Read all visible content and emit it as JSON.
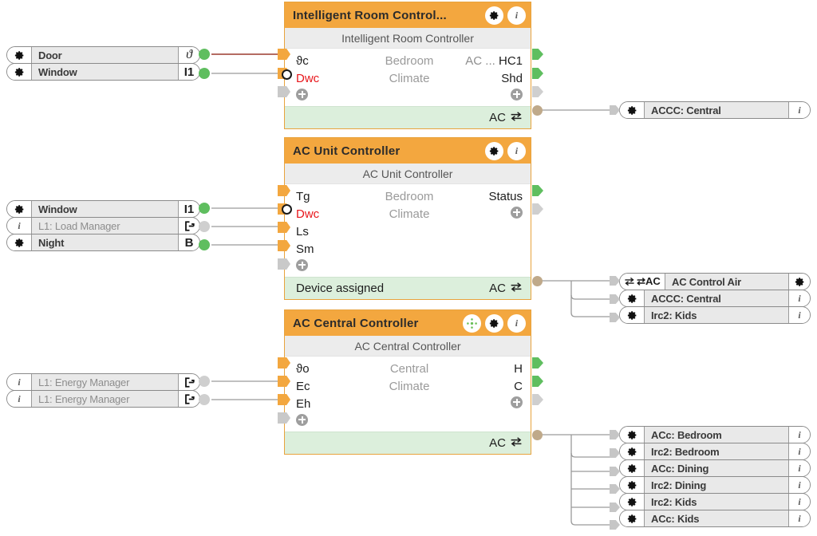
{
  "meta": {
    "accent_orange": "#f3a73f",
    "footer_green": "#dcefdc",
    "port_green": "#5fbe5f",
    "port_tan": "#bfa98a",
    "red_label": "#e8161b",
    "wire_gray": "#9a9a9a",
    "wire_red": "#9b3a2e"
  },
  "source_nodes": {
    "group1": [
      {
        "icon": "gear-icon",
        "label": "Door",
        "symbol": "ϑ",
        "symbol_name": "theta-icon",
        "out_state": "connected"
      },
      {
        "icon": "gear-icon",
        "label": "Window",
        "symbol": "I1",
        "symbol_name": "input-one-icon",
        "out_state": "connected"
      }
    ],
    "group2": [
      {
        "icon": "gear-icon",
        "label": "Window",
        "symbol": "I1",
        "symbol_name": "input-one-icon",
        "out_state": "connected"
      },
      {
        "icon": "info-icon",
        "label": "L1: Load Manager",
        "symbol": "→]",
        "symbol_name": "export-icon",
        "out_state": "inactive"
      },
      {
        "icon": "gear-icon",
        "label": "Night",
        "symbol": "B",
        "symbol_name": "boolean-icon",
        "out_state": "connected"
      }
    ],
    "group3": [
      {
        "icon": "info-icon",
        "label": "L1: Energy Manager",
        "symbol": "→]",
        "symbol_name": "export-icon",
        "out_state": "inactive"
      },
      {
        "icon": "info-icon",
        "label": "L1: Energy Manager",
        "symbol": "→]",
        "symbol_name": "export-icon",
        "out_state": "inactive"
      }
    ]
  },
  "blocks": [
    {
      "id": "intelligent-room-controller",
      "title": "Intelligent  Room  Control...",
      "subtitle": "Intelligent Room Controller",
      "title_buttons": [
        "gear-icon",
        "info-icon"
      ],
      "rows": [
        {
          "left": "ϑc",
          "left_red": false,
          "center": "Bedroom",
          "right_muted": "AC ...",
          "right": "HC1",
          "in_port": "active",
          "out_port": "active"
        },
        {
          "left": "Dwc",
          "left_red": true,
          "center": "Climate",
          "right_muted": "",
          "right": "Shd",
          "in_port": "active",
          "out_port": "active"
        },
        {
          "left": "+",
          "left_red": false,
          "center": "",
          "right_muted": "",
          "right": "+",
          "in_port": "inactive",
          "out_port": "inactive"
        }
      ],
      "footer_text": "",
      "footer_right": "AC",
      "footer_icon": "swap-arrows-icon"
    },
    {
      "id": "ac-unit-controller",
      "title": "AC Unit Controller",
      "subtitle": "AC Unit Controller",
      "title_buttons": [
        "gear-icon",
        "info-icon"
      ],
      "rows": [
        {
          "left": "Tg",
          "left_red": false,
          "center": "Bedroom",
          "right_muted": "",
          "right": "Status",
          "in_port": "active",
          "out_port": "active"
        },
        {
          "left": "Dwc",
          "left_red": true,
          "center": "Climate",
          "right_muted": "",
          "right": "+",
          "in_port": "active",
          "out_port": "inactive"
        },
        {
          "left": "Ls",
          "left_red": false,
          "center": "",
          "right_muted": "",
          "right": "",
          "in_port": "active",
          "out_port": "none"
        },
        {
          "left": "Sm",
          "left_red": false,
          "center": "",
          "right_muted": "",
          "right": "",
          "in_port": "active",
          "out_port": "none"
        },
        {
          "left": "+",
          "left_red": false,
          "center": "",
          "right_muted": "",
          "right": "",
          "in_port": "inactive",
          "out_port": "none"
        }
      ],
      "footer_text": "Device assigned",
      "footer_right": "AC",
      "footer_icon": "swap-arrows-icon"
    },
    {
      "id": "ac-central-controller",
      "title": "AC Central Controller",
      "subtitle": "AC Central Controller",
      "title_buttons": [
        "network-icon",
        "gear-icon",
        "info-icon"
      ],
      "rows": [
        {
          "left": "ϑo",
          "left_red": false,
          "center": "Central",
          "right_muted": "",
          "right": "H",
          "in_port": "active",
          "out_port": "active"
        },
        {
          "left": "Ec",
          "left_red": false,
          "center": "Climate",
          "right_muted": "",
          "right": "C",
          "in_port": "active",
          "out_port": "active"
        },
        {
          "left": "Eh",
          "left_red": false,
          "center": "",
          "right_muted": "",
          "right": "+",
          "in_port": "active",
          "out_port": "inactive"
        },
        {
          "left": "+",
          "left_red": false,
          "center": "",
          "right_muted": "",
          "right": "",
          "in_port": "inactive",
          "out_port": "none"
        }
      ],
      "footer_text": "",
      "footer_right": "AC",
      "footer_icon": "swap-arrows-icon"
    }
  ],
  "target_nodes": {
    "group1": [
      {
        "icon": "gear-icon",
        "label": "ACCC: Central",
        "right_icon": "info-icon"
      }
    ],
    "group2": [
      {
        "icon": "swap-ac-icon",
        "icon_text": "⇄AC",
        "label": "AC Control Air",
        "right_icon": "gear-icon"
      },
      {
        "icon": "gear-icon",
        "label": "ACCC: Central",
        "right_icon": "info-icon"
      },
      {
        "icon": "gear-icon",
        "label": "Irc2: Kids",
        "right_icon": "info-icon"
      }
    ],
    "group3": [
      {
        "icon": "gear-icon",
        "label": "ACc: Bedroom",
        "right_icon": "info-icon"
      },
      {
        "icon": "gear-icon",
        "label": "Irc2: Bedroom",
        "right_icon": "info-icon"
      },
      {
        "icon": "gear-icon",
        "label": "ACc: Dining",
        "right_icon": "info-icon"
      },
      {
        "icon": "gear-icon",
        "label": "Irc2: Dining",
        "right_icon": "info-icon"
      },
      {
        "icon": "gear-icon",
        "label": "Irc2: Kids",
        "right_icon": "info-icon"
      },
      {
        "icon": "gear-icon",
        "label": "ACc: Kids",
        "right_icon": "info-icon"
      }
    ]
  }
}
